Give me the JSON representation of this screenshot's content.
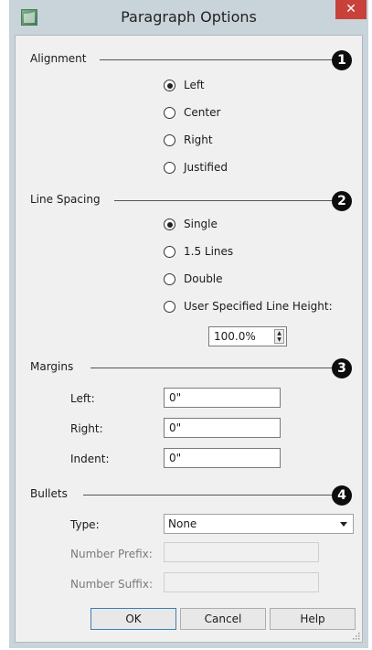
{
  "window": {
    "title": "Paragraph Options",
    "close_glyph": "✕",
    "app_icon": "app-logo-icon"
  },
  "alignment": {
    "label": "Alignment",
    "badge": "1",
    "options": [
      "Left",
      "Center",
      "Right",
      "Justified"
    ],
    "selected": "Left"
  },
  "line_spacing": {
    "label": "Line Spacing",
    "badge": "2",
    "options": [
      "Single",
      "1.5 Lines",
      "Double",
      "User Specified Line Height:"
    ],
    "selected": "Single",
    "line_height_value": "100.0%"
  },
  "margins": {
    "label": "Margins",
    "badge": "3",
    "left_label": "Left:",
    "left_value": "0\"",
    "right_label": "Right:",
    "right_value": "0\"",
    "indent_label": "Indent:",
    "indent_value": "0\""
  },
  "bullets": {
    "label": "Bullets",
    "badge": "4",
    "type_label": "Type:",
    "type_value": "None",
    "prefix_label": "Number Prefix:",
    "prefix_value": "",
    "suffix_label": "Number Suffix:",
    "suffix_value": ""
  },
  "buttons": {
    "ok": "OK",
    "cancel": "Cancel",
    "help": "Help"
  },
  "colors": {
    "chrome": "#c9d3da",
    "close": "#c8423b",
    "badge": "#0d0d0d",
    "default_button_border": "#3c7fb1"
  }
}
